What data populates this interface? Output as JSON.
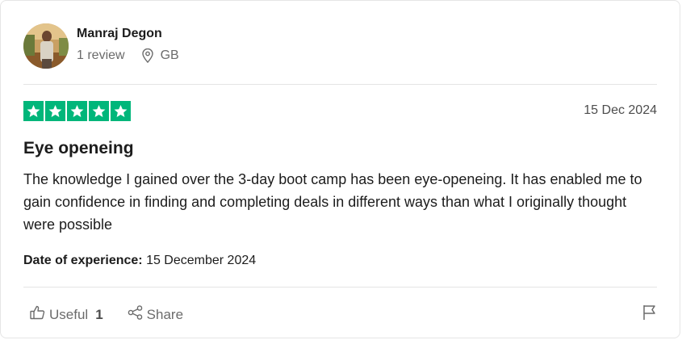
{
  "reviewer": {
    "name": "Manraj Degon",
    "review_count": "1 review",
    "country": "GB"
  },
  "review": {
    "rating": 5,
    "rating_color": "#00b67a",
    "date": "15 Dec 2024",
    "title": "Eye openeing",
    "body": "The knowledge I gained over the 3-day boot camp has been eye-openeing. It has enabled me to gain confidence in finding and completing deals in different ways than what I originally thought were possible",
    "experience_label": "Date of experience:",
    "experience_date": "15 December 2024"
  },
  "actions": {
    "useful_label": "Useful",
    "useful_count": "1",
    "share_label": "Share"
  },
  "icons": {
    "location": "location-pin-icon",
    "thumbs_up": "thumbs-up-icon",
    "share": "share-icon",
    "flag": "flag-icon",
    "star": "star-icon"
  }
}
